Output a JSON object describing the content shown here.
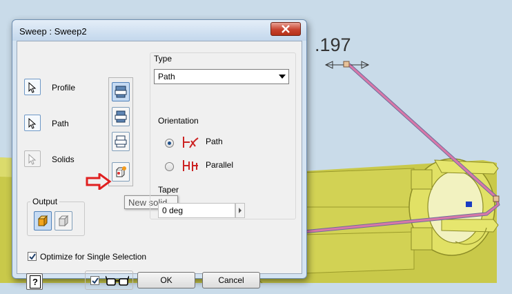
{
  "viewport": {
    "dimension_label": ".197"
  },
  "dialog": {
    "title": "Sweep : Sweep2",
    "selectors": [
      {
        "label": "Profile",
        "state": "active"
      },
      {
        "label": "Path",
        "state": "active"
      },
      {
        "label": "Solids",
        "state": "disabled"
      }
    ],
    "tooltip": "New solid",
    "output": {
      "legend": "Output",
      "modes": [
        "solid",
        "surface"
      ],
      "selected": "solid"
    },
    "type": {
      "label": "Type",
      "value": "Path"
    },
    "orientation": {
      "label": "Orientation",
      "options": [
        {
          "label": "Path",
          "checked": true
        },
        {
          "label": "Parallel",
          "checked": false
        }
      ]
    },
    "taper": {
      "label": "Taper",
      "value": "0 deg"
    },
    "optimize_label": "Optimize for Single Selection",
    "optimize_checked": true,
    "preview_checked": true,
    "ok_label": "OK",
    "cancel_label": "Cancel"
  },
  "colors": {
    "accent": "#4f80b8",
    "close_red": "#c7432f",
    "arrow_red": "#e02020",
    "path_pink": "#d878a8",
    "body_yellow": "#d6d64e"
  }
}
